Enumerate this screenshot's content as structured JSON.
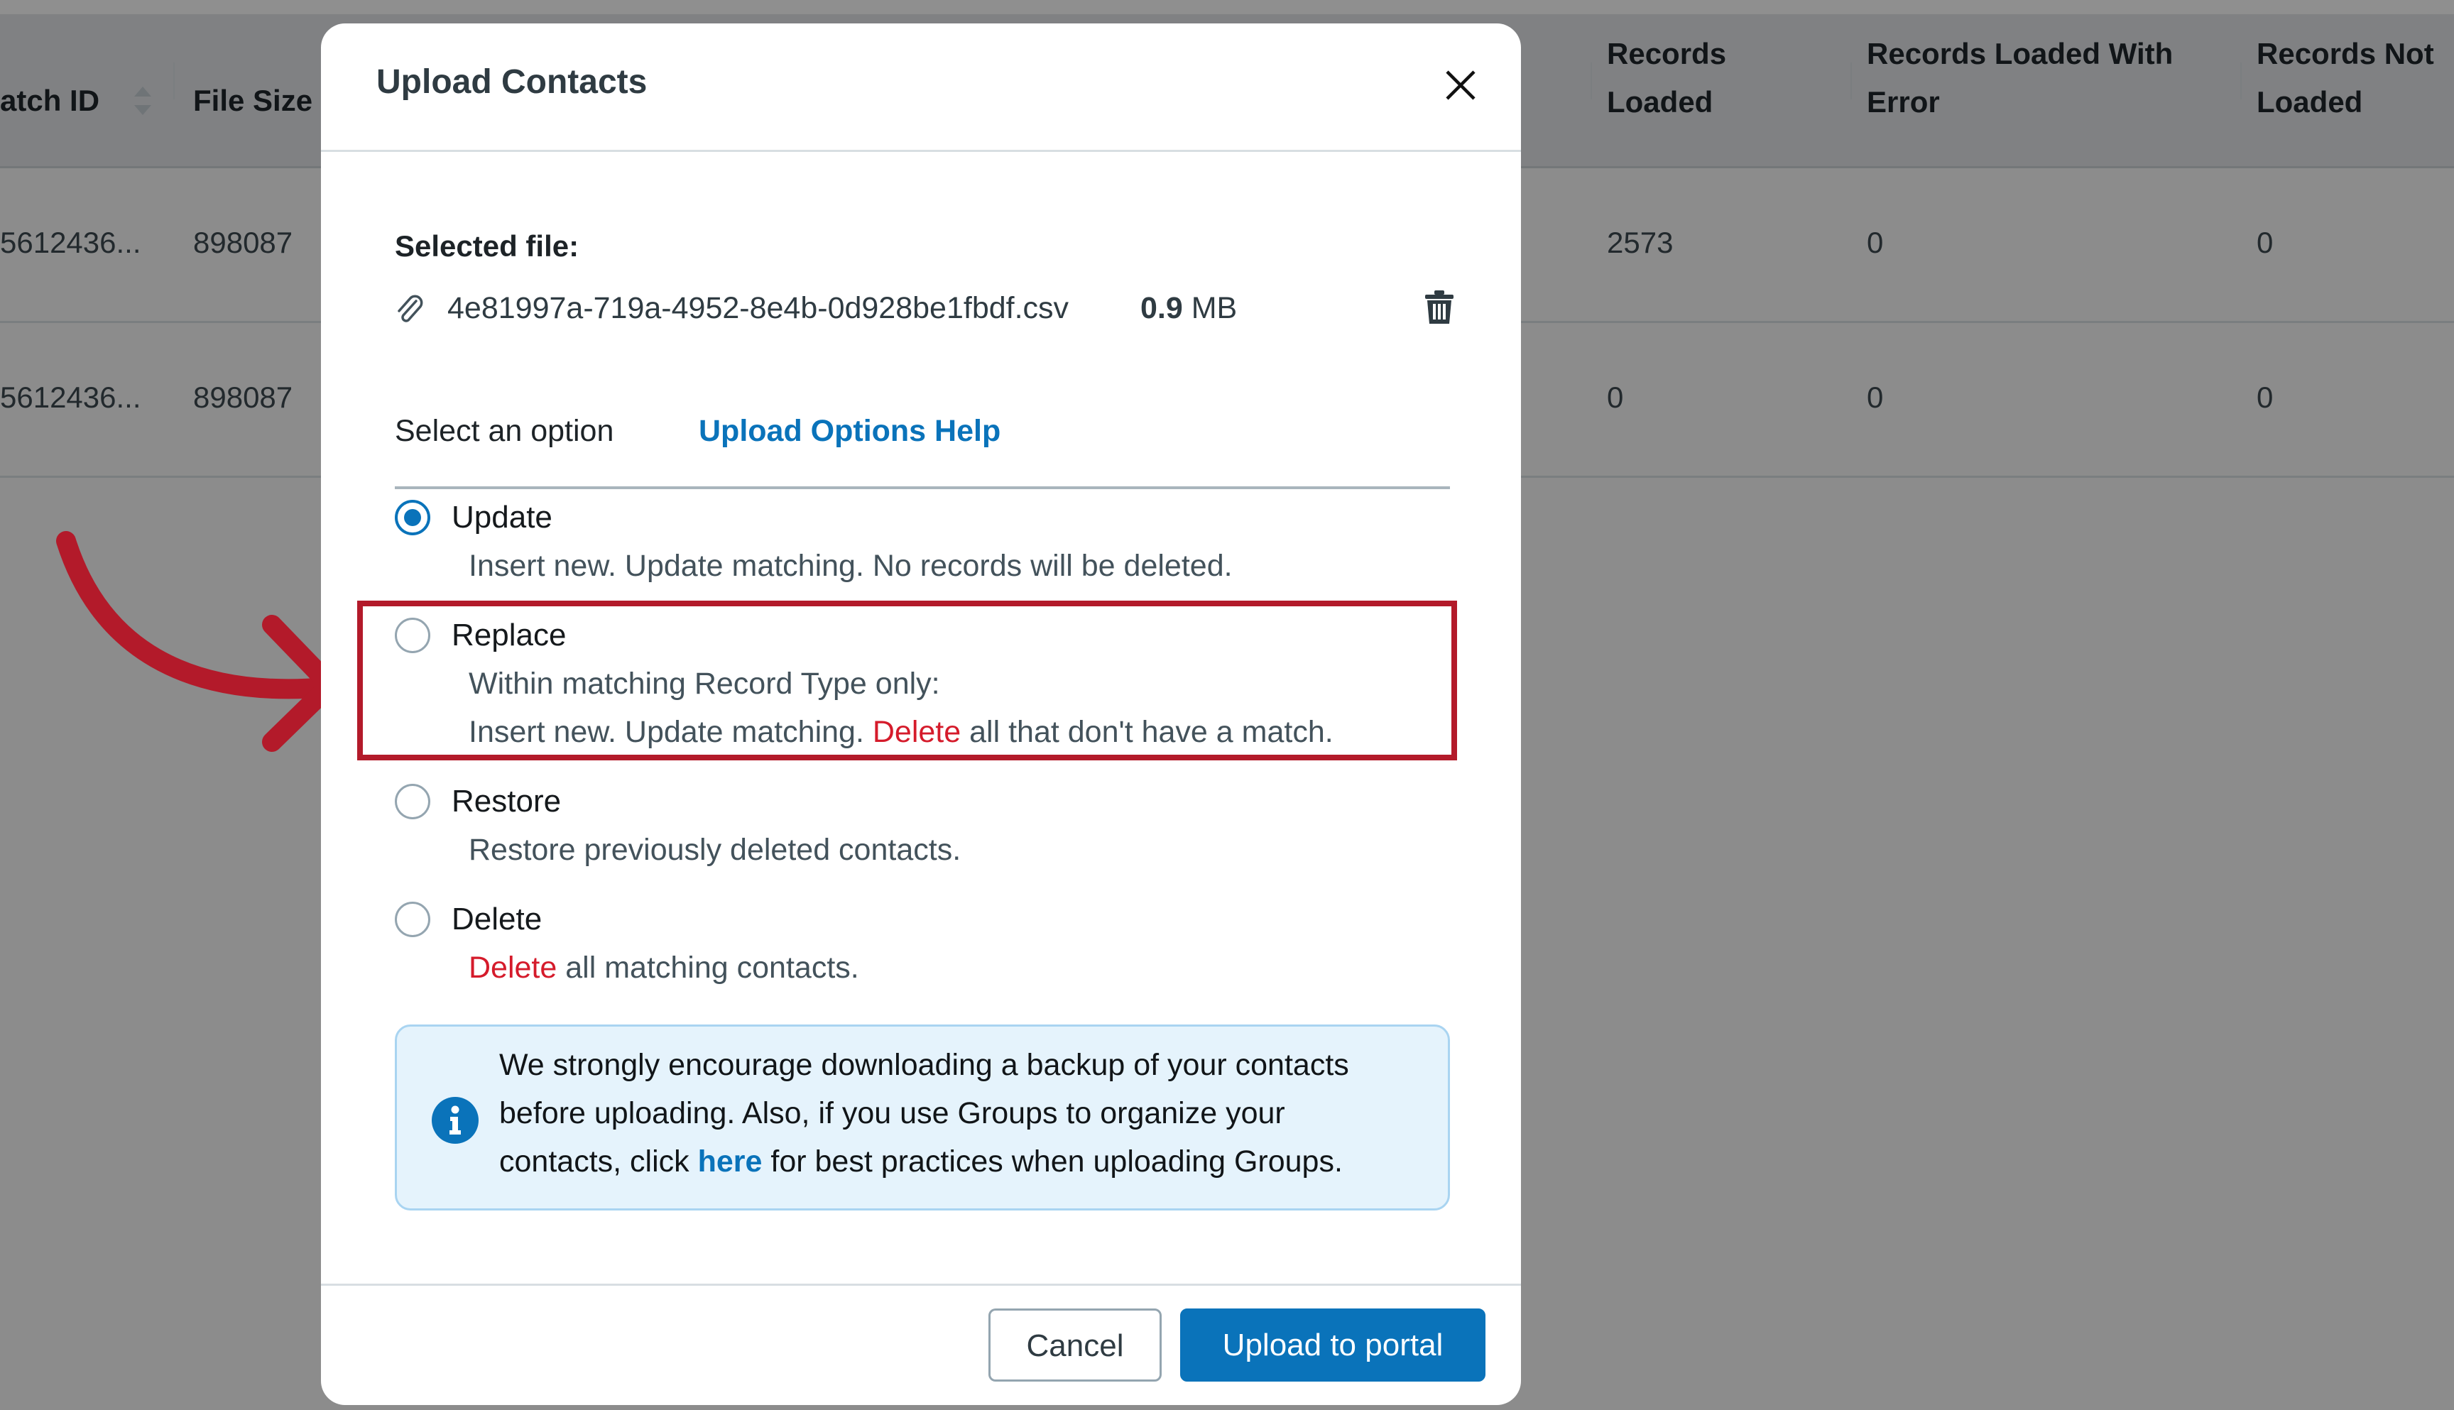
{
  "background_table": {
    "columns": [
      {
        "label_line1": "atch ID",
        "label_line2": "",
        "sortable": true
      },
      {
        "label_line1": "File Size",
        "label_line2": ""
      },
      {
        "label_line1": "Records",
        "label_line2": "Loaded"
      },
      {
        "label_line1": "Records Loaded With",
        "label_line2": "Error"
      },
      {
        "label_line1": "Records Not",
        "label_line2": "Loaded"
      }
    ],
    "rows": [
      {
        "batch_id": "5612436...",
        "file_size": "898087",
        "records_loaded": "2573",
        "loaded_with_error": "0",
        "not_loaded": "0"
      },
      {
        "batch_id": "5612436...",
        "file_size": "898087",
        "records_loaded": "0",
        "loaded_with_error": "0",
        "not_loaded": "0"
      }
    ]
  },
  "modal": {
    "title": "Upload Contacts",
    "close_icon": "close-icon",
    "selected_file_label": "Selected file:",
    "file": {
      "icon": "paperclip-icon",
      "name": "4e81997a-719a-4952-8e4b-0d928be1fbdf.csv",
      "size_value": "0.9",
      "size_unit": "MB",
      "delete_icon": "trash-icon"
    },
    "select_option_label": "Select an option",
    "help_link": "Upload Options Help",
    "options": [
      {
        "label": "Update",
        "checked": true,
        "desc_lines": [
          {
            "pre": "Insert new. Update matching. No records will be deleted.",
            "danger": "",
            "post": ""
          }
        ]
      },
      {
        "label": "Replace",
        "checked": false,
        "highlighted": true,
        "desc_lines": [
          {
            "pre": "Within matching Record Type only:",
            "danger": "",
            "post": ""
          },
          {
            "pre": "Insert new. Update matching. ",
            "danger": "Delete",
            "post": " all that don't have a match."
          }
        ]
      },
      {
        "label": "Restore",
        "checked": false,
        "desc_lines": [
          {
            "pre": "Restore previously deleted contacts.",
            "danger": "",
            "post": ""
          }
        ]
      },
      {
        "label": "Delete",
        "checked": false,
        "desc_lines": [
          {
            "pre": "",
            "danger": "Delete",
            "post": " all matching contacts."
          }
        ]
      }
    ],
    "info": {
      "icon": "info-icon",
      "line1": "We strongly encourage downloading a backup of your contacts",
      "line2": "before uploading. Also, if you use Groups to organize your",
      "line3_pre": "contacts, click ",
      "line3_link": "here",
      "line3_post": " for best practices when uploading Groups."
    },
    "buttons": {
      "cancel": "Cancel",
      "primary": "Upload to portal"
    }
  },
  "annotation": {
    "arrow_icon": "curved-arrow-icon",
    "color": "#b31a2a"
  },
  "colors": {
    "accent": "#0a73ba",
    "danger": "#d51b2b",
    "annotation": "#b31a2a",
    "info_bg": "#e5f3fc"
  }
}
